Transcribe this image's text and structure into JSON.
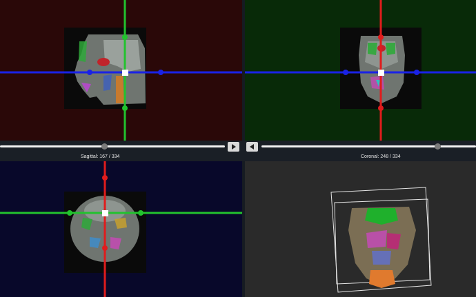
{
  "sagittal": {
    "label": "Sagittal: 167 / 334",
    "crosshair_vertical_color": "#22c22e",
    "crosshair_horizontal_color": "#1a22e6",
    "background": "#2a0808"
  },
  "coronal": {
    "label": "Coronal: 248 / 334",
    "crosshair_vertical_color": "#e01c1c",
    "crosshair_horizontal_color": "#1a22e6",
    "background": "#082a08"
  },
  "axial": {
    "crosshair_vertical_color": "#e01c1c",
    "crosshair_horizontal_color": "#22c22e",
    "background": "#08082a"
  },
  "render3d": {
    "background": "#2a2a2a"
  },
  "controls": {
    "next_icon": "play-triangle-right-icon",
    "prev_icon": "play-triangle-left-icon"
  }
}
